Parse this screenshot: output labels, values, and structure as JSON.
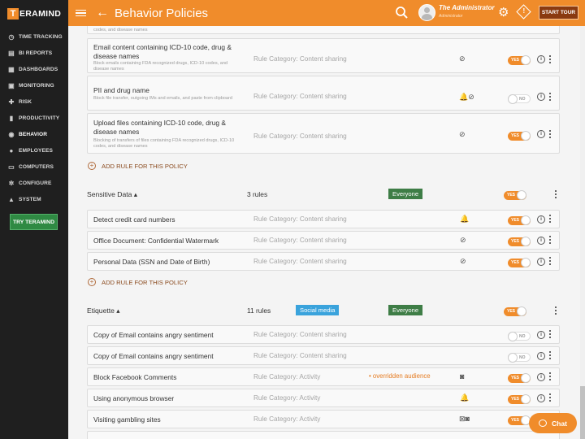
{
  "app": {
    "logo_letter": "T",
    "logo_text": "ERAMIND",
    "page_title": "Behavior Policies"
  },
  "user": {
    "name": "The Administrator",
    "role": "Administrator"
  },
  "header": {
    "tour_label": "START TOUR",
    "alert_glyph": "!"
  },
  "sidebar": {
    "items": [
      {
        "label": "TIME TRACKING",
        "icon": "◷"
      },
      {
        "label": "BI REPORTS",
        "icon": "▤"
      },
      {
        "label": "DASHBOARDS",
        "icon": "▦"
      },
      {
        "label": "MONITORING",
        "icon": "▣"
      },
      {
        "label": "RISK",
        "icon": "✚"
      },
      {
        "label": "PRODUCTIVITY",
        "icon": "▮"
      },
      {
        "label": "BEHAVIOR",
        "icon": "◉"
      },
      {
        "label": "EMPLOYEES",
        "icon": "●"
      },
      {
        "label": "COMPUTERS",
        "icon": "▭"
      },
      {
        "label": "CONFIGURE",
        "icon": "✲"
      },
      {
        "label": "SYSTEM",
        "icon": "▲"
      }
    ],
    "active": "BEHAVIOR",
    "try_label": "TRY TERAMIND"
  },
  "top_partial": {
    "desc": "codes, and disease names"
  },
  "group1_rules": [
    {
      "name": "Email content containing ICD-10 code, drug & disease names",
      "desc": "Block emails containing FDA recognized drugs, ICD-10 codes, and disease names",
      "category": "Rule Category: Content sharing",
      "icons": "⊘",
      "toggle": "YES",
      "on": true
    },
    {
      "name": "PII and drug name",
      "desc": "Block file transfer, outgoing IMs and emails, and paste from clipboard",
      "category": "Rule Category: Content sharing",
      "icons": "🔔⊘",
      "toggle": "NO",
      "on": false
    },
    {
      "name": "Upload files containing ICD-10 code, drug & disease names",
      "desc": "Blocking of transfers of files containing FDA recognized drugs, ICD-10 codes, and disease names",
      "category": "Rule Category: Content sharing",
      "icons": "⊘",
      "toggle": "YES",
      "on": true
    }
  ],
  "add_rule_label": "ADD RULE FOR THIS POLICY",
  "policy_sensitive": {
    "name": "Sensitive Data ▴",
    "count": "3 rules",
    "audience": "Everyone",
    "toggle": "YES"
  },
  "sensitive_rules": [
    {
      "name": "Detect credit card numbers",
      "category": "Rule Category: Content sharing",
      "icons": "🔔",
      "toggle": "YES"
    },
    {
      "name": "Office Document: Confidential Watermark",
      "category": "Rule Category: Content sharing",
      "icons": "⊘",
      "toggle": "YES"
    },
    {
      "name": "Personal Data (SSN and Date of Birth)",
      "category": "Rule Category: Content sharing",
      "icons": "⊘",
      "toggle": "YES"
    }
  ],
  "policy_etiquette": {
    "name": "Etiquette ▴",
    "count": "11 rules",
    "tag": "Social media",
    "audience": "Everyone",
    "toggle": "YES"
  },
  "etiquette_rules": [
    {
      "name": "Copy of Email contains angry sentiment",
      "category": "Rule Category: Content sharing",
      "icons": "",
      "toggle": "NO",
      "on": false
    },
    {
      "name": "Copy of Email contains angry sentiment",
      "category": "Rule Category: Content sharing",
      "icons": "",
      "toggle": "NO",
      "on": false
    },
    {
      "name": "Block Facebook Comments",
      "category": "Rule Category: Activity",
      "override": "• overridden audience",
      "icons": "◙",
      "toggle": "YES",
      "on": true
    },
    {
      "name": "Using anonymous browser",
      "category": "Rule Category: Activity",
      "icons": "🔔",
      "toggle": "YES",
      "on": true
    },
    {
      "name": "Visiting gambling sites",
      "category": "Rule Category: Activity",
      "icons": "⊠◙",
      "toggle": "YES",
      "on": true
    }
  ],
  "info_glyph": "i",
  "chat_label": "Chat"
}
